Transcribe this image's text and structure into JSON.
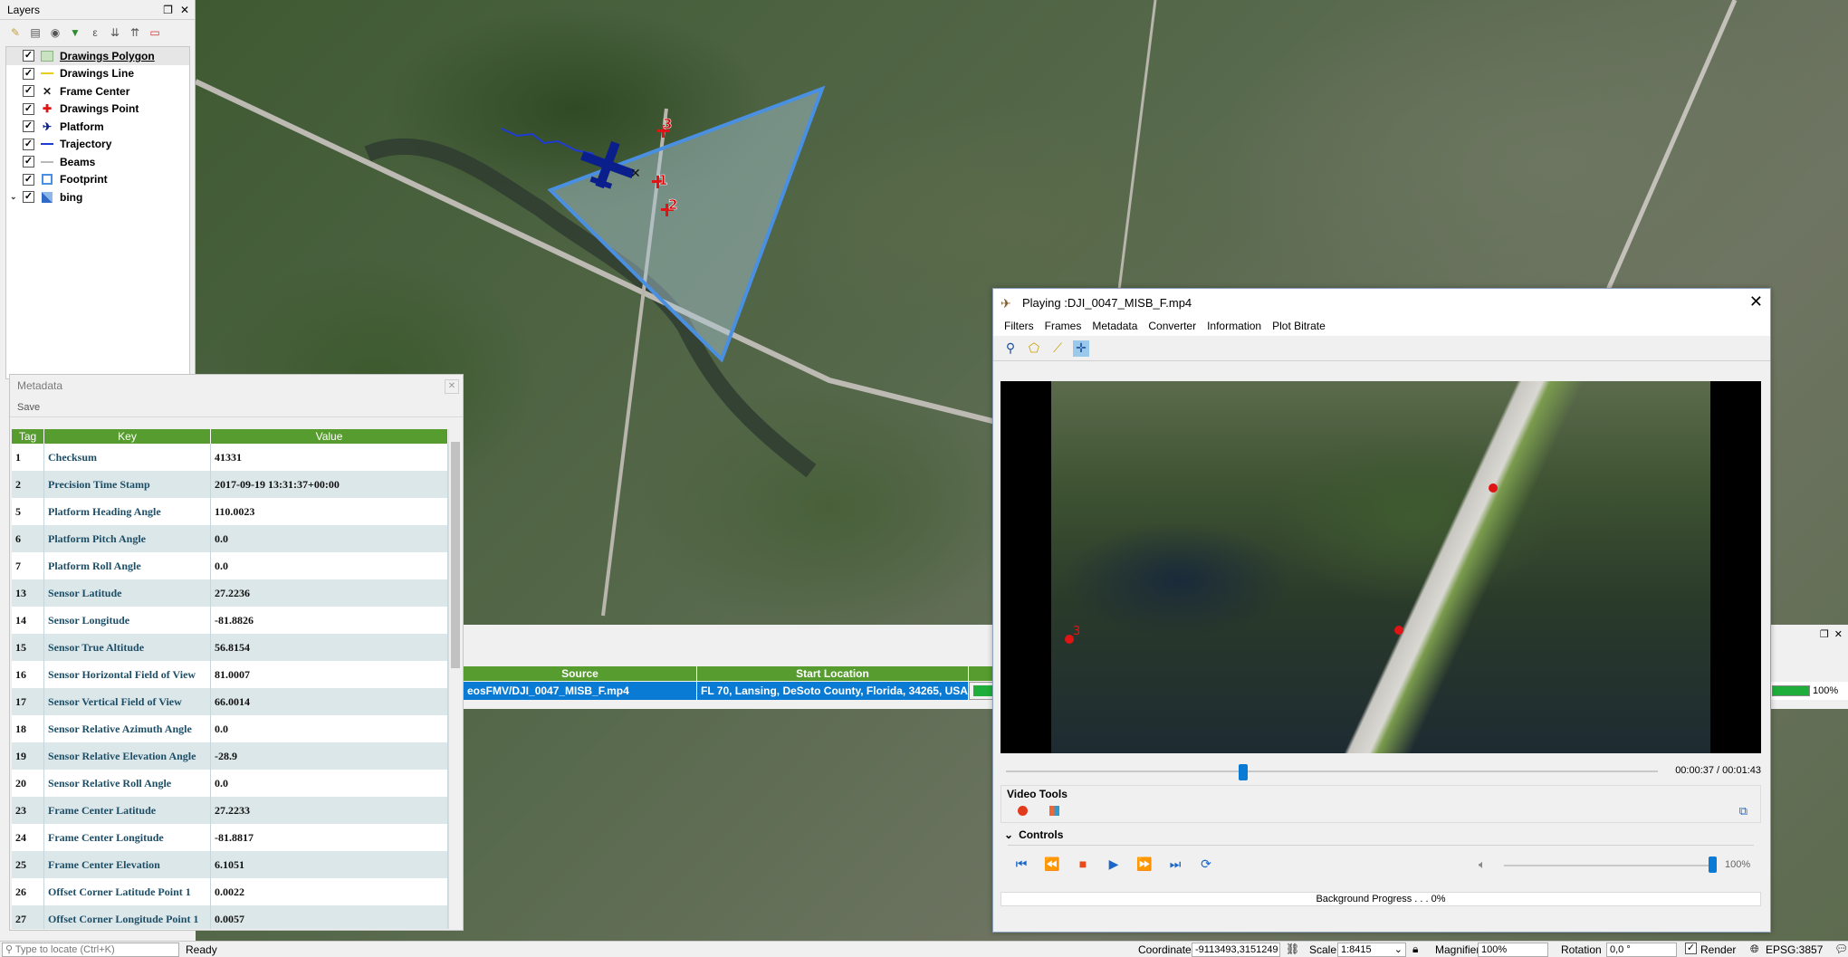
{
  "layers_panel": {
    "title": "Layers",
    "items": [
      {
        "label": "Drawings Polygon",
        "checked": true,
        "icon": "polygon-symbol-icon"
      },
      {
        "label": "Drawings Line",
        "checked": true,
        "icon": "line-symbol-icon"
      },
      {
        "label": "Frame Center",
        "checked": true,
        "icon": "x-symbol-icon"
      },
      {
        "label": "Drawings Point",
        "checked": true,
        "icon": "red-cross-symbol-icon"
      },
      {
        "label": "Platform",
        "checked": true,
        "icon": "airplane-symbol-icon"
      },
      {
        "label": "Trajectory",
        "checked": true,
        "icon": "blue-line-symbol-icon"
      },
      {
        "label": "Beams",
        "checked": true,
        "icon": "gray-line-symbol-icon"
      },
      {
        "label": "Footprint",
        "checked": true,
        "icon": "square-outline-symbol-icon"
      },
      {
        "label": "bing",
        "checked": true,
        "icon": "raster-icon"
      }
    ]
  },
  "map": {
    "point_labels": [
      "1",
      "2",
      "3"
    ]
  },
  "metadata_panel": {
    "title": "Metadata",
    "save_label": "Save",
    "columns": [
      "Tag",
      "Key",
      "Value"
    ],
    "rows": [
      {
        "tag": "1",
        "key": "Checksum",
        "value": "41331"
      },
      {
        "tag": "2",
        "key": "Precision Time Stamp",
        "value": "2017-09-19 13:31:37+00:00"
      },
      {
        "tag": "5",
        "key": "Platform Heading Angle",
        "value": "110.0023"
      },
      {
        "tag": "6",
        "key": "Platform Pitch Angle",
        "value": "0.0"
      },
      {
        "tag": "7",
        "key": "Platform Roll Angle",
        "value": "0.0"
      },
      {
        "tag": "13",
        "key": "Sensor Latitude",
        "value": "27.2236"
      },
      {
        "tag": "14",
        "key": "Sensor Longitude",
        "value": "-81.8826"
      },
      {
        "tag": "15",
        "key": "Sensor True Altitude",
        "value": "56.8154"
      },
      {
        "tag": "16",
        "key": "Sensor Horizontal Field of View",
        "value": "81.0007"
      },
      {
        "tag": "17",
        "key": "Sensor Vertical Field of View",
        "value": "66.0014"
      },
      {
        "tag": "18",
        "key": "Sensor Relative Azimuth Angle",
        "value": "0.0"
      },
      {
        "tag": "19",
        "key": "Sensor Relative Elevation Angle",
        "value": "-28.9"
      },
      {
        "tag": "20",
        "key": "Sensor Relative Roll Angle",
        "value": "0.0"
      },
      {
        "tag": "23",
        "key": "Frame Center Latitude",
        "value": "27.2233"
      },
      {
        "tag": "24",
        "key": "Frame Center Longitude",
        "value": "-81.8817"
      },
      {
        "tag": "25",
        "key": "Frame Center Elevation",
        "value": "6.1051"
      },
      {
        "tag": "26",
        "key": "Offset Corner Latitude Point 1",
        "value": "0.0022"
      },
      {
        "tag": "27",
        "key": "Offset Corner Longitude Point 1",
        "value": "0.0057"
      }
    ]
  },
  "video_list": {
    "columns": [
      "Source",
      "Start Location"
    ],
    "row": {
      "source": "eosFMV/DJI_0047_MISB_F.mp4",
      "start_location": "FL 70, Lansing, DeSoto County, Florida, 34265, USA",
      "progress": "100%"
    }
  },
  "player": {
    "title": "Playing :DJI_0047_MISB_F.mp4",
    "menu": [
      "Filters",
      "Frames",
      "Metadata",
      "Converter",
      "Information",
      "Plot Bitrate"
    ],
    "time": "00:00:37 / 00:01:43",
    "video_tools_label": "Video Tools",
    "controls_label": "Controls",
    "volume": "100%",
    "background_progress": "Background Progress . . . 0%",
    "video_point_label": "3"
  },
  "statusbar": {
    "locate_placeholder": "Type to locate (Ctrl+K)",
    "ready": "Ready",
    "coordinate_label": "Coordinate",
    "coordinate_value": "-9113493,3151249",
    "scale_label": "Scale",
    "scale_value": "1:8415",
    "magnifier_label": "Magnifier",
    "magnifier_value": "100%",
    "rotation_label": "Rotation",
    "rotation_value": "0,0 °",
    "render_label": "Render",
    "crs": "EPSG:3857"
  },
  "colors": {
    "accent_green": "#569c2f",
    "selection_blue": "#0a7bd4",
    "footprint_blue": "#4a90e2",
    "platform_navy": "#0a1e8c",
    "point_red": "#e01414"
  }
}
